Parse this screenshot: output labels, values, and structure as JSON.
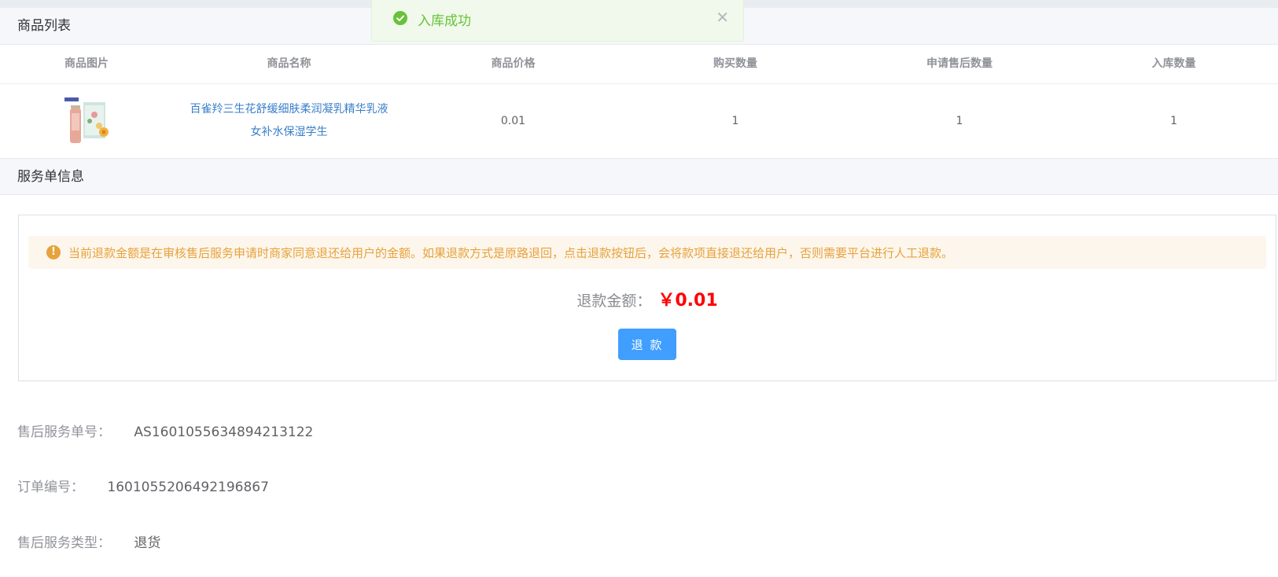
{
  "goods_section": {
    "title": "商品列表",
    "columns": [
      "商品图片",
      "商品名称",
      "商品价格",
      "购买数量",
      "申请售后数量",
      "入库数量"
    ],
    "rows": [
      {
        "image_icon": "product-image",
        "name": "百雀羚三生花舒缓细肤柔润凝乳精华乳液女补水保湿学生",
        "price": "0.01",
        "buy_qty": "1",
        "aftersale_qty": "1",
        "stock_in_qty": "1"
      }
    ]
  },
  "service_section": {
    "title": "服务单信息",
    "alert": "当前退款金额是在审核售后服务申请时商家同意退还给用户的金额。如果退款方式是原路退回，点击退款按钮后，会将款项直接退还给用户，否则需要平台进行人工退款。",
    "amount_label": "退款金额：",
    "amount_value": "￥0.01",
    "refund_button": "退 款"
  },
  "info": [
    {
      "label": "售后服务单号：",
      "value": "AS1601055634894213122"
    },
    {
      "label": "订单编号：",
      "value": "1601055206492196867"
    },
    {
      "label": "售后服务类型：",
      "value": "退货"
    }
  ],
  "toast": {
    "message": "入库成功",
    "type": "success"
  },
  "colors": {
    "primary": "#409eff",
    "success": "#67c23a",
    "warning": "#e6a23c",
    "danger": "#ff0000",
    "link": "#3a7fc8"
  }
}
